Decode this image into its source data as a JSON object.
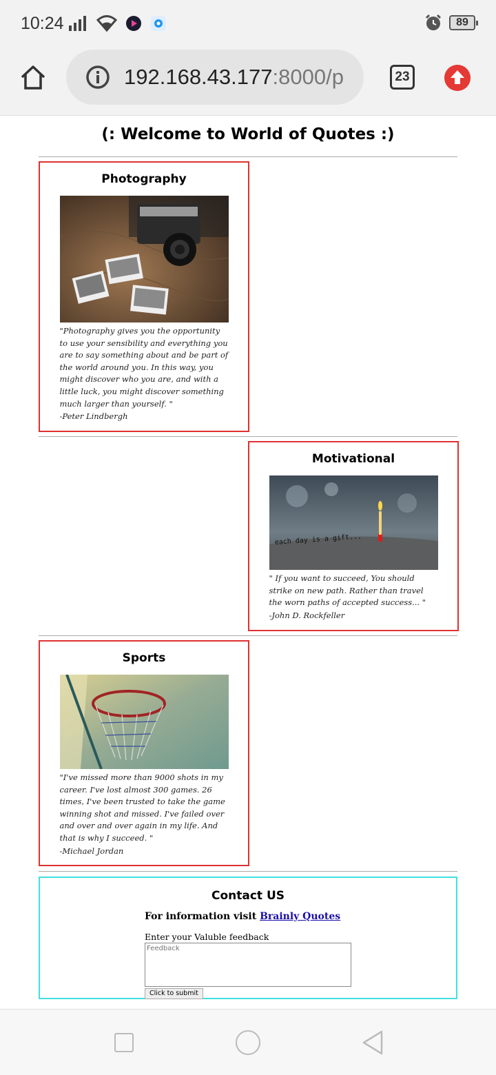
{
  "status_bar": {
    "time": "10:24",
    "battery": "89"
  },
  "browser": {
    "url_host": "192.168.43.177",
    "url_path": ":8000/p",
    "tab_count": "23"
  },
  "page": {
    "title": "(: Welcome to World of Quotes :)",
    "cards": [
      {
        "title": "Photography",
        "image": "camera-with-polaroid-photos",
        "quote": "\"Photography gives you the opportunity to use your sensibility and everything you are to say something about and be part of the world around you. In this way, you might discover who you are, and with a little luck, you might discover something much larger than yourself. \"",
        "author": "-Peter Lindbergh"
      },
      {
        "title": "Motivational",
        "image": "candle-on-stone-each-day-is-a-gift",
        "image_caption": "each day is a gift...",
        "quote": "\" If you want to succeed, You should strike on new path. Rather than travel the worn paths of accepted success... \"",
        "author": "-John D. Rockfeller"
      },
      {
        "title": "Sports",
        "image": "basketball-hoop",
        "quote": "\"I've missed more than 9000 shots in my career. I've lost almost 300 games. 26 times, I've been trusted to take the game winning shot and missed. I've failed over and over and over again in my life. And that is why I succeed. \"",
        "author": "-Michael Jordan"
      }
    ],
    "contact": {
      "title": "Contact US",
      "info_prefix": "For information visit",
      "info_link": "Brainly Quotes",
      "feedback_label": "Enter your Valuble feedback",
      "feedback_placeholder": "Feedback",
      "submit_label": "Click to submit"
    }
  },
  "colors": {
    "card_border": "#e03030",
    "contact_border": "#40e0e0",
    "link": "#1a0dab",
    "update_button": "#e53935"
  }
}
